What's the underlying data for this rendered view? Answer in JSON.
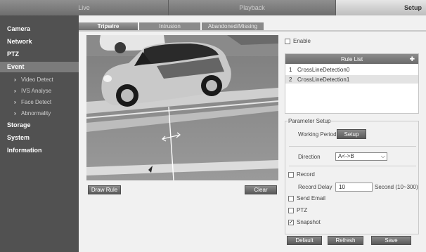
{
  "topnav": {
    "live": "Live",
    "playback": "Playback",
    "setup": "Setup"
  },
  "sidebar": {
    "camera": "Camera",
    "network": "Network",
    "ptz": "PTZ",
    "event": "Event",
    "video_detect": "Video Detect",
    "ivs_analyse": "IVS Analyse",
    "face_detect": "Face Detect",
    "abnormality": "Abnormality",
    "storage": "Storage",
    "system": "System",
    "information": "Information"
  },
  "subtabs": {
    "tripwire": "Tripwire",
    "intrusion": "Intrusion",
    "abandoned": "Abandoned/Missing"
  },
  "video": {
    "draw_rule": "Draw Rule",
    "clear": "Clear"
  },
  "enable_label": "Enable",
  "rule_list": {
    "title": "Rule List",
    "rows": [
      {
        "num": "1",
        "name": "CrossLineDetection0"
      },
      {
        "num": "2",
        "name": "CrossLineDetection1"
      }
    ]
  },
  "param": {
    "title": "Parameter Setup",
    "working_period": "Working Period",
    "setup_btn": "Setup",
    "direction_label": "Direction",
    "direction_value": "A<->B",
    "record": "Record",
    "record_delay": "Record Delay",
    "record_delay_value": "10",
    "record_delay_unit": "Second (10~300)",
    "send_email": "Send Email",
    "ptz": "PTZ",
    "snapshot": "Snapshot",
    "snapshot_checked": "✓"
  },
  "buttons": {
    "default": "Default",
    "refresh": "Refresh",
    "save": "Save"
  }
}
